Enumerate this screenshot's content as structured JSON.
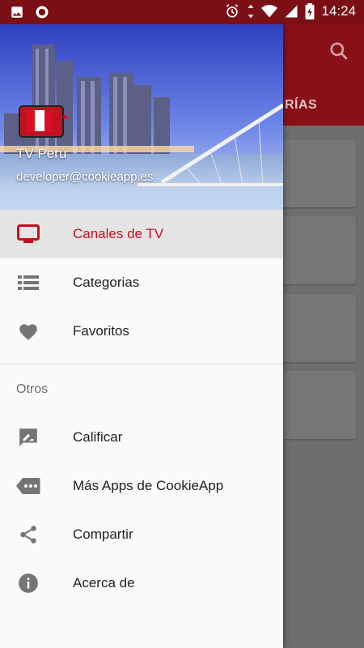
{
  "status_bar": {
    "time": "14:24"
  },
  "background_app": {
    "tab_label": "RÍAS"
  },
  "drawer": {
    "app_name": "TV Perú",
    "email": "developer@cookieapp.es",
    "items": [
      {
        "label": "Canales de TV",
        "icon": "tv-icon",
        "active": true
      },
      {
        "label": "Categorias",
        "icon": "list-icon",
        "active": false
      },
      {
        "label": "Favoritos",
        "icon": "heart-icon",
        "active": false
      }
    ],
    "section_title": "Otros",
    "other_items": [
      {
        "label": "Calificar",
        "icon": "rate-review-icon"
      },
      {
        "label": "Más Apps de CookieApp",
        "icon": "more-apps-icon"
      },
      {
        "label": "Compartir",
        "icon": "share-icon"
      },
      {
        "label": "Acerca de",
        "icon": "info-icon"
      }
    ]
  },
  "colors": {
    "accent": "#c40f1d",
    "status_bar": "#7b0f16",
    "toolbar": "#8a1018"
  }
}
